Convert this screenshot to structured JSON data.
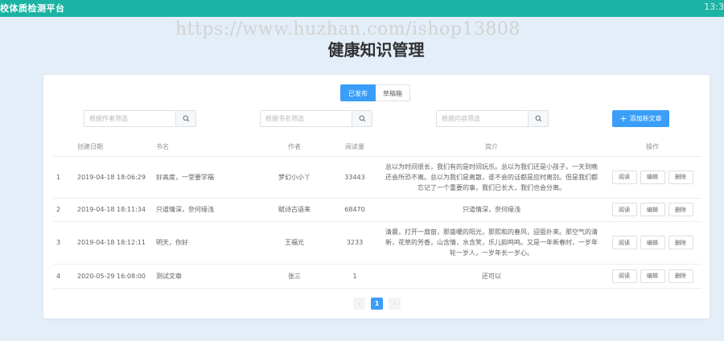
{
  "app": {
    "title": "校体质检测平台",
    "clock": "13:3",
    "watermark": "https://www.huzhan.com/ishop13808"
  },
  "page": {
    "title": "健康知识管理"
  },
  "tabs": [
    {
      "label": "已发布",
      "active": true
    },
    {
      "label": "草稿箱",
      "active": false
    }
  ],
  "search": {
    "author_placeholder": "根据作者筛选",
    "book_placeholder": "根据书名筛选",
    "content_placeholder": "根据内容筛选"
  },
  "toolbar": {
    "add_label": "添加新文章"
  },
  "table": {
    "headers": {
      "index": "",
      "date": "创建日期",
      "book": "书名",
      "author": "作者",
      "reads": "阅读量",
      "brief": "简介",
      "ops": "操作"
    },
    "rows": [
      {
        "index": "1",
        "date": "2019-04-18 18:06:29",
        "book": "好高度，一堂要学福",
        "author": "梦幻小小丫",
        "reads": "33443",
        "brief": "总以为时间很长，我们有的是时间玩乐。总以为我们还是小孩子，一天到晚还会所恐不离。总以为我们是离散，谁不会的话都是应时离别。但是我们都忘记了一个重要的事，我们已长大，我们也会分离。",
        "ops": [
          "阅读",
          "编辑",
          "删除"
        ]
      },
      {
        "index": "2",
        "date": "2019-04-18 18:11:34",
        "book": "只道情深，奈何缘浅",
        "author": "赋诗古语来",
        "reads": "68470",
        "brief": "只道情深，奈何缘浅",
        "ops": [
          "阅读",
          "编辑",
          "删除"
        ]
      },
      {
        "index": "3",
        "date": "2019-04-18 18:12:11",
        "book": "明天，你好",
        "author": "王福光",
        "reads": "3233",
        "brief": "清晨，打开一扇窗，那盛暖的阳光，那熙和的春风，迎面扑来。那空气的清新，花草的芳香，山含情，水含笑，乐儿韵鸣鸣。又是一年新春时，一岁年轮一岁人，一岁年长一岁心。",
        "ops": [
          "阅读",
          "编辑",
          "删除"
        ]
      },
      {
        "index": "4",
        "date": "2020-05-29 16:08:00",
        "book": "测试文章",
        "author": "张三",
        "reads": "1",
        "brief": "还可以",
        "ops": [
          "阅读",
          "编辑",
          "删除"
        ]
      }
    ]
  },
  "pagination": {
    "prev": "‹",
    "current": "1",
    "next": "›"
  },
  "colors": {
    "header": "#1bb3a3",
    "primary": "#3a9ef8",
    "background": "#e4eef8"
  }
}
